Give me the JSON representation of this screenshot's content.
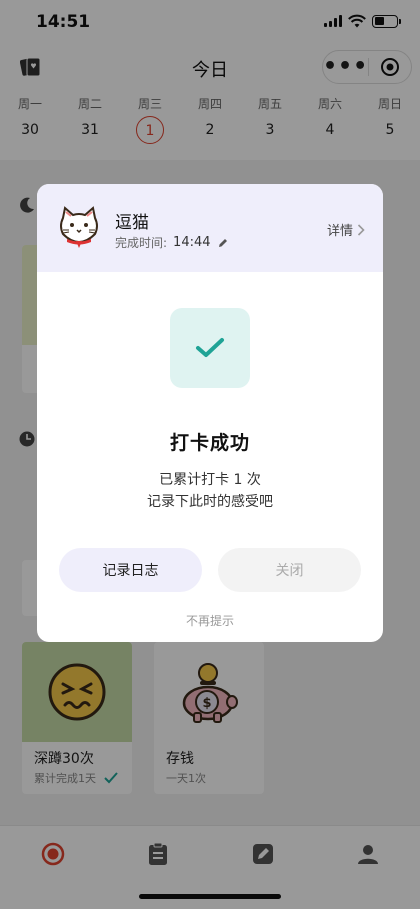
{
  "status_bar": {
    "time": "14:51"
  },
  "header": {
    "title": "今日",
    "more_label": "•••"
  },
  "week": {
    "days": [
      {
        "name": "周一",
        "date": "30"
      },
      {
        "name": "周二",
        "date": "31"
      },
      {
        "name": "周三",
        "date": "1"
      },
      {
        "name": "周四",
        "date": "2"
      },
      {
        "name": "周五",
        "date": "3"
      },
      {
        "name": "周六",
        "date": "4"
      },
      {
        "name": "周日",
        "date": "5"
      }
    ],
    "today_color": "#e0432f"
  },
  "habits": [
    {
      "name": "深蹲30次",
      "status": "累计完成1天",
      "bg_color": "#c5dba7"
    },
    {
      "name": "存钱",
      "status": "一天1次",
      "bg_color": "#ffffff"
    }
  ],
  "modal": {
    "habit_name": "逗猫",
    "done_time_label": "完成时间:",
    "done_time": "14:44",
    "detail_label": "详情",
    "success_title": "打卡成功",
    "count_text": "已累计打卡 1 次",
    "prompt_text": "记录下此时的感受吧",
    "journal_button": "记录日志",
    "close_button": "关闭",
    "no_remind": "不再提示",
    "accent_color": "#1fa396"
  },
  "tabbar": {
    "items": [
      {
        "icon": "record-icon",
        "color": "#e0432f"
      },
      {
        "icon": "clipboard-icon",
        "color": "#555555"
      },
      {
        "icon": "edit-icon",
        "color": "#555555"
      },
      {
        "icon": "user-icon",
        "color": "#555555"
      }
    ]
  }
}
